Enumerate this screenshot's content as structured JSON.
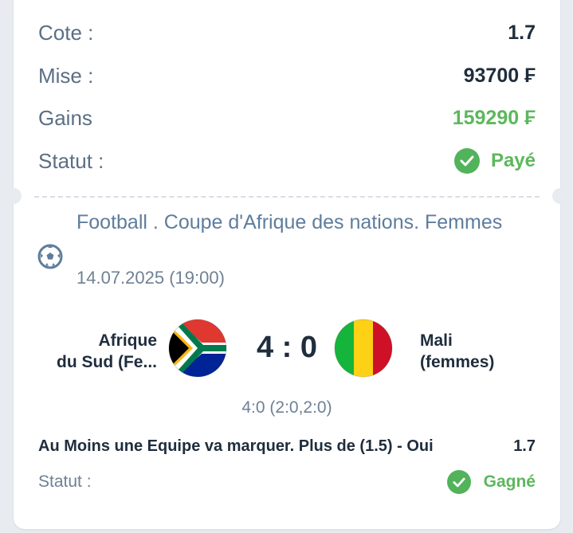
{
  "summary": {
    "odds_label": "Cote :",
    "odds_value": "1.7",
    "stake_label": "Mise :",
    "stake_value": "93700 ₣",
    "gains_label": "Gains",
    "gains_value": "159290 ₣",
    "status_label": "Statut :",
    "status_value": "Payé"
  },
  "event": {
    "league": "Football . Coupe d'Afrique des nations. Femmes",
    "sport_icon": "soccer-ball-icon",
    "date": "14.07.2025 (19:00)",
    "home_team_line1": "Afrique",
    "home_team_line2": "du Sud (Fe...",
    "away_team_line1": "Mali",
    "away_team_line2": "(femmes)",
    "score": "4 : 0",
    "detail_score": "4:0 (2:0,2:0)",
    "market": "Au Moins une Equipe va marquer. Plus de (1.5) - Oui",
    "market_odds": "1.7",
    "status_label": "Statut :",
    "status_value": "Gagné"
  },
  "colors": {
    "accent_green": "#52b35a",
    "text_dark": "#1f2d3d",
    "text_muted": "#5b6f84",
    "league_blue": "#5e7d9c",
    "flag_mali": [
      "#14b53a",
      "#fcd116",
      "#ce1126"
    ]
  }
}
